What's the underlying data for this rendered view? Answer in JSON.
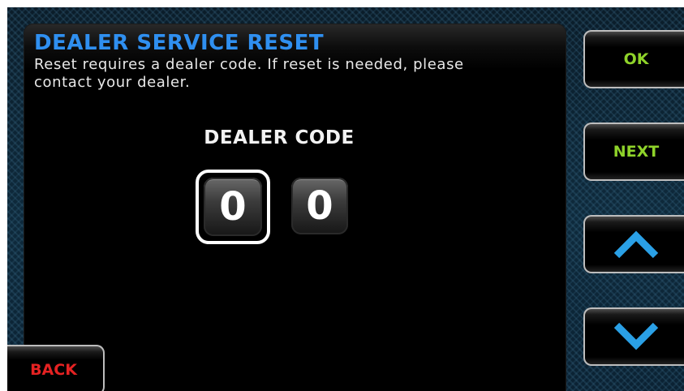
{
  "dialog": {
    "title": "DEALER SERVICE RESET",
    "description": "Reset requires a dealer code. If reset is needed, please contact your dealer."
  },
  "dealer_code": {
    "label": "DEALER CODE",
    "digits": [
      "0",
      "0"
    ],
    "selected_index": 0
  },
  "side_buttons": {
    "ok_label": "OK",
    "next_label": "NEXT",
    "up_icon": "chevron-up-icon",
    "down_icon": "chevron-down-icon"
  },
  "back_button": {
    "label": "BACK"
  },
  "colors": {
    "title": "#2f8ff0",
    "button_text_green": "#8fd32a",
    "back_text_red": "#e52222",
    "arrow_blue": "#2aa0e6"
  }
}
